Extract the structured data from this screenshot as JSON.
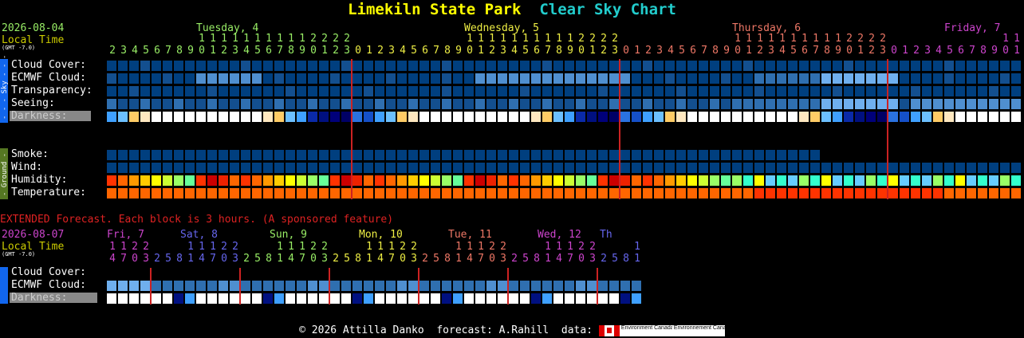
{
  "title": {
    "park": "Limekiln State Park",
    "chart": "Clear Sky Chart"
  },
  "colors": {
    "title_park": "#ffff00",
    "title_chart": "#22cccc",
    "date": "#cccc00",
    "local": "#cccc00",
    "vline": "#cc2222"
  },
  "header": {
    "date": "2026-08-04",
    "local_time": "Local Time",
    "gmt": "(GMT -7.0)",
    "days": [
      {
        "label": "Tuesday, 4",
        "color": "#99ee66"
      },
      {
        "label": "Wednesday, 5",
        "color": "#eeee44"
      },
      {
        "label": "Thursday, 6",
        "color": "#ee7766"
      },
      {
        "label": "Friday, 7",
        "color": "#cc44cc"
      }
    ],
    "hours": [
      "2",
      "3",
      "4",
      "5",
      "6",
      "7",
      "8",
      "9",
      "10",
      "11",
      "12",
      "13",
      "14",
      "15",
      "16",
      "17",
      "18",
      "19",
      "20",
      "21",
      "22",
      "23",
      "0",
      "1",
      "2",
      "3",
      "4",
      "5",
      "6",
      "7",
      "8",
      "9",
      "10",
      "11",
      "12",
      "13",
      "14",
      "15",
      "16",
      "17",
      "18",
      "19",
      "20",
      "21",
      "22",
      "23",
      "0",
      "1",
      "2",
      "3",
      "4",
      "5",
      "6",
      "7",
      "8",
      "9",
      "10",
      "11",
      "12",
      "13",
      "14",
      "15",
      "16",
      "17",
      "18",
      "19",
      "20",
      "21",
      "22",
      "23",
      "0",
      "1",
      "2",
      "3",
      "4",
      "5",
      "6",
      "7",
      "8",
      "9",
      "10",
      "11"
    ]
  },
  "rows": {
    "cloud": "Cloud Cover:",
    "ecmwf": "ECMWF Cloud:",
    "transparency": "Transparency:",
    "seeing": "Seeing:",
    "darkness": "Darkness:",
    "smoke": "Smoke:",
    "wind": "Wind:",
    "humidity": "Humidity:",
    "temperature": "Temperature:"
  },
  "side": {
    "sky": "- - - Sky - - -",
    "ground": "- Ground -"
  },
  "extended": {
    "banner": "EXTENDED Forecast. Each block is 3 hours. (A sponsored feature)",
    "date": "2026-08-07",
    "local_time": "Local Time",
    "gmt": "(GMT -7.0)",
    "days": [
      {
        "label": "Fri, 7",
        "color": "#cc44cc"
      },
      {
        "label": "Sat, 8",
        "color": "#6666ee"
      },
      {
        "label": "Sun, 9",
        "color": "#99ee66"
      },
      {
        "label": "Mon, 10",
        "color": "#eeee44"
      },
      {
        "label": "Tue, 11",
        "color": "#ee7766"
      },
      {
        "label": "Wed, 12",
        "color": "#cc44cc"
      },
      {
        "label": "Th",
        "color": "#6666ee"
      }
    ],
    "hours": [
      "14",
      "17",
      "20",
      "23",
      "2",
      "5",
      "8",
      "11",
      "14",
      "17",
      "20",
      "23",
      "2",
      "5",
      "8",
      "11",
      "14",
      "17",
      "20",
      "23",
      "2",
      "5",
      "8",
      "11",
      "14",
      "17",
      "20",
      "23",
      "2",
      "5",
      "8",
      "11",
      "14",
      "17",
      "20",
      "23",
      "2",
      "5",
      "8",
      "11",
      "14",
      "17",
      "20",
      "23",
      "2",
      "5",
      "8",
      "11"
    ],
    "cloud": "Cloud Cover:",
    "ecmwf": "ECMWF Cloud:",
    "darkness": "Darkness:"
  },
  "footer": {
    "copyright": "© 2026 Attilla Danko",
    "forecast": "forecast: A.Rahill",
    "data": "data:",
    "env1": "Environment Canada",
    "env2": "Environnement Canada"
  }
}
